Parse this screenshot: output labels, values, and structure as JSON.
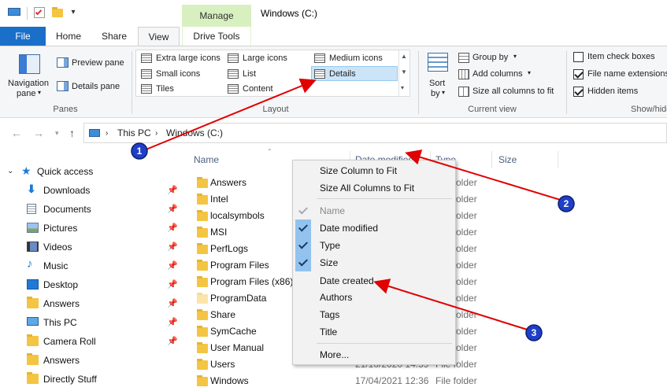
{
  "window": {
    "title": "Windows (C:)",
    "context_tab": "Manage"
  },
  "ribbon_tabs": [
    {
      "label": "File"
    },
    {
      "label": "Home"
    },
    {
      "label": "Share"
    },
    {
      "label": "View"
    },
    {
      "label": "Drive Tools"
    }
  ],
  "panes_group": {
    "navigation_pane_label": "Navigation\npane",
    "nav_line1": "Navigation",
    "nav_line2": "pane",
    "preview_pane": "Preview pane",
    "details_pane": "Details pane",
    "label": "Panes"
  },
  "layout_group": {
    "items": [
      "Extra large icons",
      "Large icons",
      "Medium icons",
      "Small icons",
      "List",
      "Details",
      "Tiles",
      "Content"
    ],
    "selected": "Details",
    "label": "Layout"
  },
  "current_view_group": {
    "sort_by_line1": "Sort",
    "sort_by_line2": "by",
    "group_by": "Group by",
    "add_columns": "Add columns",
    "size_all_columns": "Size all columns to fit",
    "label": "Current view"
  },
  "show_hide_group": {
    "item_check_boxes": {
      "label": "Item check boxes",
      "checked": false
    },
    "file_name_extensions": {
      "label": "File name extensions",
      "checked": true
    },
    "hidden_items": {
      "label": "Hidden items",
      "checked": true
    },
    "label": "Show/hide"
  },
  "address": {
    "crumbs": [
      "This PC",
      "Windows (C:)"
    ]
  },
  "nav_pane": {
    "quick_access": "Quick access",
    "items": [
      {
        "label": "Downloads",
        "icon": "download-icon",
        "pinned": true
      },
      {
        "label": "Documents",
        "icon": "document-icon",
        "pinned": true
      },
      {
        "label": "Pictures",
        "icon": "pictures-icon",
        "pinned": true
      },
      {
        "label": "Videos",
        "icon": "video-icon",
        "pinned": true
      },
      {
        "label": "Music",
        "icon": "music-icon",
        "pinned": true
      },
      {
        "label": "Desktop",
        "icon": "desktop-icon",
        "pinned": true
      },
      {
        "label": "Answers",
        "icon": "folder-icon",
        "pinned": true
      },
      {
        "label": "This PC",
        "icon": "computer-icon",
        "pinned": true
      },
      {
        "label": "Camera Roll",
        "icon": "folder-icon",
        "pinned": true
      },
      {
        "label": "Answers",
        "icon": "folder-icon",
        "pinned": false
      },
      {
        "label": "Directly Stuff",
        "icon": "folder-icon",
        "pinned": false
      }
    ]
  },
  "columns": [
    "Name",
    "Date modified",
    "Type",
    "Size"
  ],
  "files": [
    {
      "name": "Answers",
      "date": "",
      "type": "File folder"
    },
    {
      "name": "Intel",
      "date": "",
      "type": "File folder"
    },
    {
      "name": "localsymbols",
      "date": "",
      "type": "File folder"
    },
    {
      "name": "MSI",
      "date": "",
      "type": "File folder"
    },
    {
      "name": "PerfLogs",
      "date": "",
      "type": "File folder"
    },
    {
      "name": "Program Files",
      "date": "",
      "type": "File folder"
    },
    {
      "name": "Program Files (x86)",
      "date": "",
      "type": "File folder"
    },
    {
      "name": "ProgramData",
      "date": "",
      "type": "File folder"
    },
    {
      "name": "Share",
      "date": "",
      "type": "File folder"
    },
    {
      "name": "SymCache",
      "date": "",
      "type": "File folder"
    },
    {
      "name": "User Manual",
      "date": "",
      "type": "File folder"
    },
    {
      "name": "Users",
      "date": "21/10/2020 14:59",
      "type": "File folder"
    },
    {
      "name": "Windows",
      "date": "17/04/2021 12:36",
      "type": "File folder"
    }
  ],
  "context_menu": {
    "items": [
      {
        "label": "Size Column to Fit",
        "checked": false,
        "disabled": false
      },
      {
        "label": "Size All Columns to Fit",
        "checked": false,
        "disabled": false
      },
      {
        "label": "Name",
        "checked": true,
        "disabled": true
      },
      {
        "label": "Date modified",
        "checked": true,
        "disabled": false
      },
      {
        "label": "Type",
        "checked": true,
        "disabled": false
      },
      {
        "label": "Size",
        "checked": true,
        "disabled": false
      },
      {
        "label": "Date created",
        "checked": false,
        "disabled": false
      },
      {
        "label": "Authors",
        "checked": false,
        "disabled": false
      },
      {
        "label": "Tags",
        "checked": false,
        "disabled": false
      },
      {
        "label": "Title",
        "checked": false,
        "disabled": false
      },
      {
        "label": "More...",
        "checked": false,
        "disabled": false
      }
    ]
  },
  "annotations": [
    "1",
    "2",
    "3"
  ],
  "colors": {
    "file_tab": "#1a6fc9",
    "manage_tab": "#d8f0c0",
    "menu_check": "#92c3ee",
    "arrow": "#e00000",
    "badge": "#1f3fc8"
  }
}
